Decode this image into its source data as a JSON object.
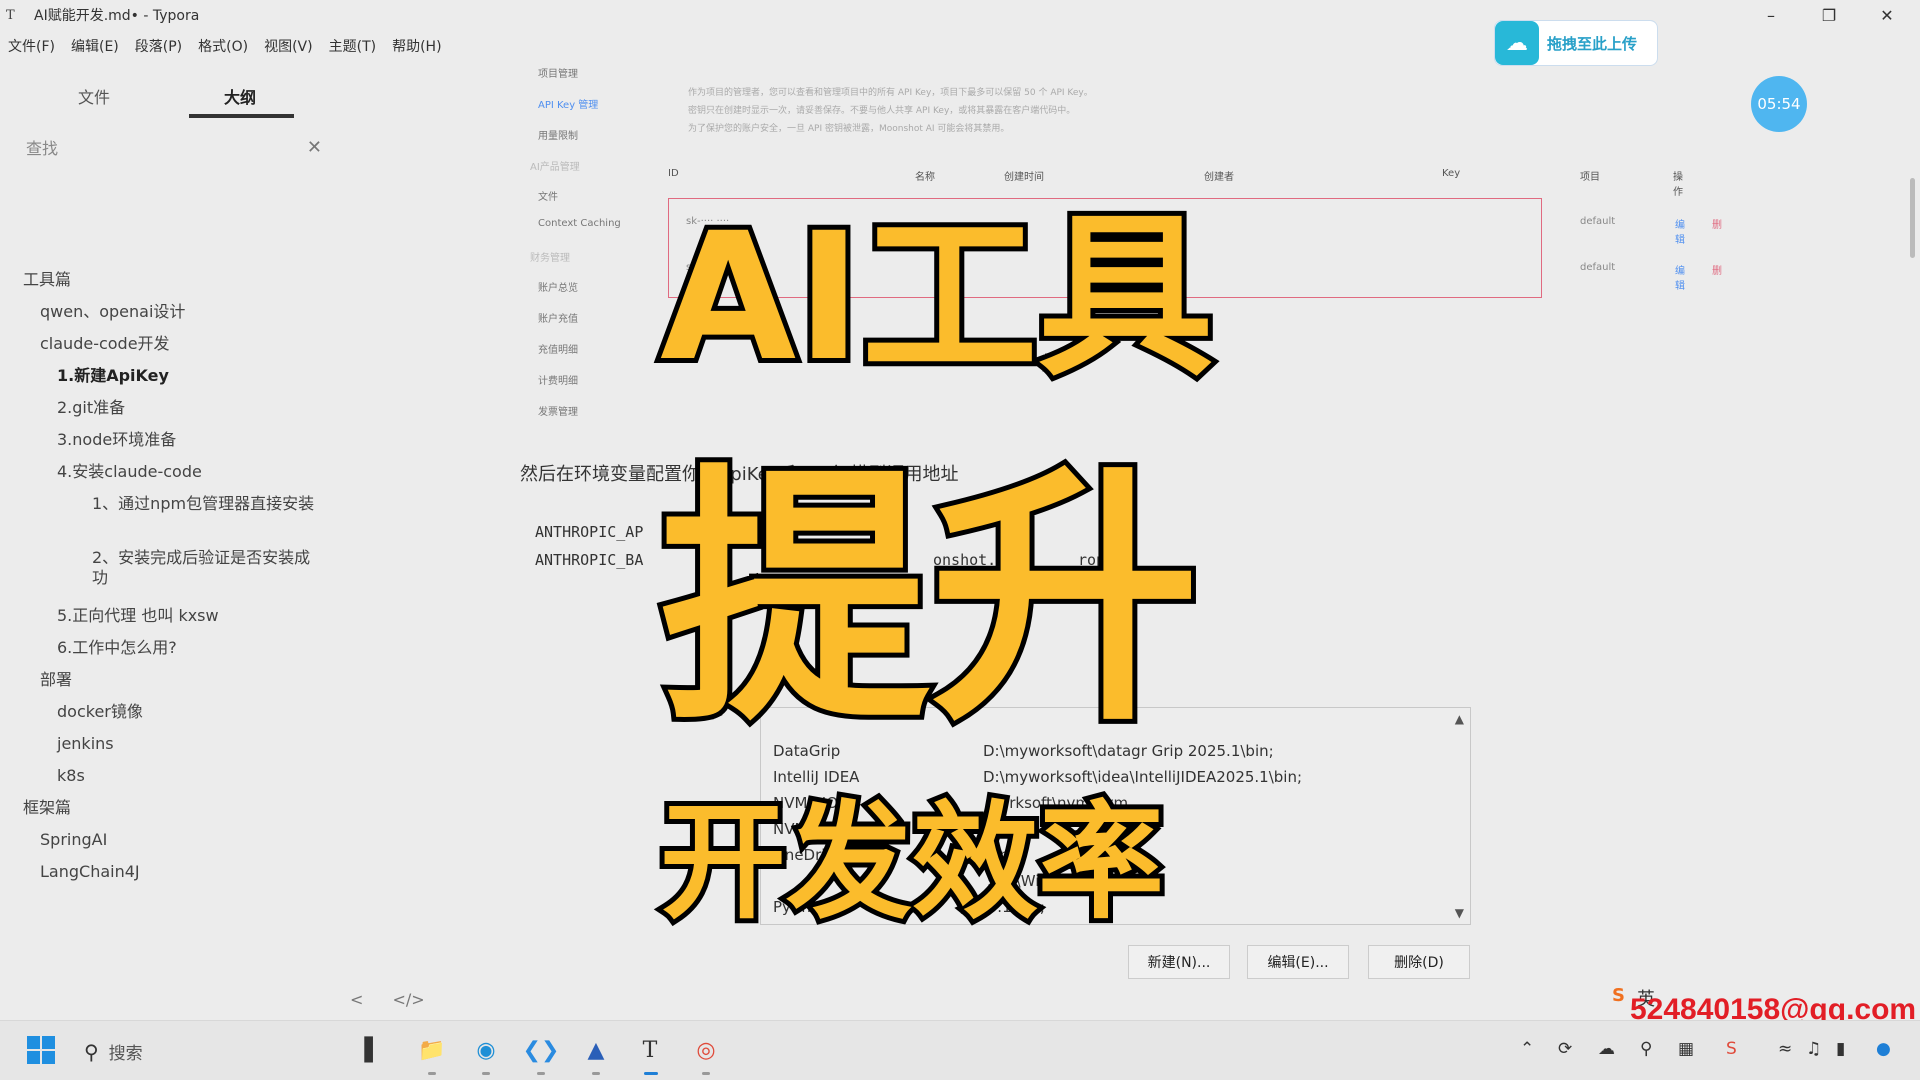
{
  "window": {
    "title": "AI赋能开发.md• - Typora",
    "app_icon": "T"
  },
  "menu": [
    "文件(F)",
    "编辑(E)",
    "段落(P)",
    "格式(O)",
    "视图(V)",
    "主题(T)",
    "帮助(H)"
  ],
  "sidebar": {
    "tabs": [
      "文件",
      "大纲"
    ],
    "search_placeholder": "查找",
    "outline": [
      {
        "label": "工具篇",
        "level": 1
      },
      {
        "label": "qwen、openai设计",
        "level": 2
      },
      {
        "label": "claude-code开发",
        "level": 2
      },
      {
        "label": "1.新建ApiKey",
        "level": 3,
        "active": true
      },
      {
        "label": "2.git准备",
        "level": 3
      },
      {
        "label": "3.node环境准备",
        "level": 3
      },
      {
        "label": "4.安装claude-code",
        "level": 3
      },
      {
        "label": "1、通过npm包管理器直接安装",
        "level": 4
      },
      {
        "label": "2、安装完成后验证是否安装成功",
        "level": 4
      },
      {
        "label": "5.正向代理 也叫 kxsw",
        "level": 3
      },
      {
        "label": "6.工作中怎么用?",
        "level": 3
      },
      {
        "label": "部署",
        "level": 2
      },
      {
        "label": "docker镜像",
        "level": 3
      },
      {
        "label": "jenkins",
        "level": 3
      },
      {
        "label": "k8s",
        "level": 3
      },
      {
        "label": "框架篇",
        "level": 1
      },
      {
        "label": "SpringAI",
        "level": 2
      },
      {
        "label": "LangChain4J",
        "level": 2
      }
    ],
    "bottom_left": "<",
    "bottom_right": "</>"
  },
  "console": {
    "nav": [
      {
        "label": "项目管理"
      },
      {
        "label": "API Key 管理",
        "active": true
      },
      {
        "label": "用量限制"
      },
      {
        "label": "AI产品管理",
        "faint": true
      },
      {
        "label": "文件"
      },
      {
        "label": "Context Caching"
      },
      {
        "label": "财务管理",
        "faint": true
      },
      {
        "label": "账户总览"
      },
      {
        "label": "账户充值"
      },
      {
        "label": "充值明细"
      },
      {
        "label": "计费明细"
      },
      {
        "label": "发票管理"
      }
    ],
    "desc": [
      "作为项目的管理者，您可以查看和管理项目中的所有 API Key，项目下最多可以保留 50 个 API Key。",
      "密钥只在创建时显示一次，请妥善保存。不要与他人共享 API Key，或将其暴露在客户端代码中。",
      "为了保护您的账户安全，一旦 API 密钥被泄露，Moonshot AI 可能会将其禁用。"
    ],
    "table_headers": [
      "ID",
      "名称",
      "创建时间",
      "创建者",
      "Key",
      "项目",
      "操作"
    ],
    "rows": [
      {
        "id": "sk-···· ····",
        "project": "default",
        "action": "编辑",
        "delete": "删"
      },
      {
        "id": "sk-···· ····",
        "project": "default",
        "action": "编辑",
        "delete": "删"
      }
    ]
  },
  "paragraph": "然后在环境变量配置你的ApiKey 和 一个 模型调用地址",
  "code_lines": [
    "ANTHROPIC_AP",
    "ANTHROPIC_BA",
    "onshot.cn/",
    "ropic/"
  ],
  "env_vars": [
    {
      "name": "DataGrip",
      "value": "D:\\myworksoft\\datagr       Grip 2025.1\\bin;"
    },
    {
      "name": "IntelliJ IDEA",
      "value": "D:\\myworksoft\\idea\\IntelliJIDEA2025.1\\bin;"
    },
    {
      "name": "NVM_HOME",
      "value": "      worksoft\\nvm\\nvm"
    },
    {
      "name": "NVM_",
      "value": ""
    },
    {
      "name": "OneDrive",
      "value": "   One"
    },
    {
      "name": "",
      "value": "             soft\\WindowsApps;D:\\..."
    },
    {
      "name": "PyCha",
      "value": "                         5.1\\bin;"
    }
  ],
  "dialog_buttons": [
    "新建(N)...",
    "编辑(E)...",
    "删除(D)"
  ],
  "overlay": {
    "line1": "AI工具",
    "line2": "提升",
    "line3": "开发效率",
    "color": "#fbbc2c"
  },
  "upload_widget": {
    "label": "拖拽至此上传"
  },
  "timer": "05:54",
  "watermark_email": "524840158@qq.com",
  "ime_indicator": "英",
  "taskbar": {
    "search_label": "搜索"
  }
}
